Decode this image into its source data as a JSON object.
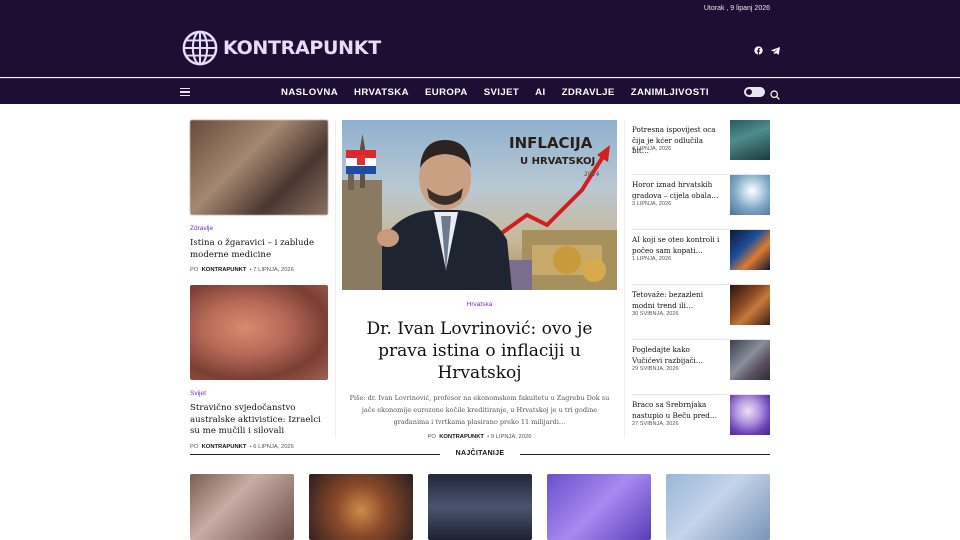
{
  "header": {
    "date": "Utorak , 9 lipanj 2026",
    "logo_text": "KONTRAPUNKT",
    "brand_color": "#1e0e33",
    "accent_color": "#7a2fd3",
    "social_icons": [
      "facebook-icon",
      "telegram-icon"
    ]
  },
  "nav": {
    "items": [
      "NASLOVNA",
      "HRVATSKA",
      "EUROPA",
      "SVIJET",
      "AI",
      "ZDRAVLJE",
      "ZANIMLJIVOSTI"
    ],
    "menu_icon": "hamburger-icon",
    "theme_toggle_icon": "dark-mode-toggle",
    "search_icon": "search-icon"
  },
  "left_articles": [
    {
      "category": "Zdravlje",
      "title": "Istina o žgaravici – i zablude moderne medicine",
      "by": "PO",
      "author": "KONTRAPUNKT",
      "date": "7 LIPNJA, 2026"
    },
    {
      "category": "Svijet",
      "title": "Stravično svjedočanstvo australske aktivistice: Izraelci su me mučili i silovali",
      "by": "PO",
      "author": "KONTRAPUNKT",
      "date": "6 LIPNJA, 2026"
    }
  ],
  "featured": {
    "category": "Hrvatska",
    "title": "Dr. Ivan Lovrinović: ovo je prava istina o inflaciji u Hrvatskoj",
    "image_headline": [
      "INFLACIJA",
      "U HRVATSKOJ"
    ],
    "image_year": "2024",
    "excerpt": "Piše: dr. Ivan Lovrinović, profesor na ekonomskom fakultetu u Zagrebu Dok su jače ekonomije eurozone kočile kreditiranje, u Hrvatskoj je u tri godine građanima i tvrtkama plasirano preko 11 milijardi…",
    "by": "PO",
    "author": "KONTRAPUNKT",
    "date": "9 LIPNJA, 2026"
  },
  "side_articles": [
    {
      "title": "Potresna ispovijest oca čija je kćer odlučila bit…",
      "date": "4 LIPNJA, 2026"
    },
    {
      "title": "Horor iznad hrvatskih gradova – cijela obala…",
      "date": "3 LIPNJA, 2026"
    },
    {
      "title": "AI koji se oteo kontroli i počeo sam kopati…",
      "date": "1 LIPNJA, 2026"
    },
    {
      "title": "Tetovaže: bezazleni modni trend ili…",
      "date": "30 SVIBNJA, 2026"
    },
    {
      "title": "Pogledajte kako Vučićevi razbijači…",
      "date": "29 SVIBNJA, 2026"
    },
    {
      "title": "Braco sa Srebrnjaka nastupio u Beču pred…",
      "date": "27 SVIBNJA, 2026"
    }
  ],
  "section": {
    "label": "NAJČITANIJE"
  }
}
